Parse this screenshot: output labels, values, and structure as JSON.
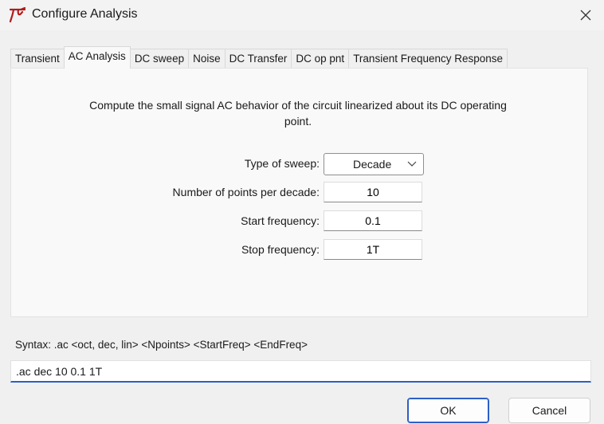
{
  "window": {
    "title": "Configure Analysis",
    "icon": "ltspice-logo-icon",
    "close_icon": "close-icon"
  },
  "tabs": [
    {
      "label": "Transient",
      "active": false
    },
    {
      "label": "AC Analysis",
      "active": true
    },
    {
      "label": "DC sweep",
      "active": false
    },
    {
      "label": "Noise",
      "active": false
    },
    {
      "label": "DC Transfer",
      "active": false
    },
    {
      "label": "DC op pnt",
      "active": false
    },
    {
      "label": "Transient Frequency Response",
      "active": false
    }
  ],
  "panel": {
    "description": "Compute the small signal AC behavior of the circuit linearized about its DC operating point.",
    "sweep_type_label": "Type of sweep:",
    "sweep_type_value": "Decade",
    "points_label": "Number of points per decade:",
    "points_value": "10",
    "start_label": "Start frequency:",
    "start_value": "0.1",
    "stop_label": "Stop frequency:",
    "stop_value": "1T"
  },
  "syntax": "Syntax:  .ac <oct, dec, lin> <Npoints> <StartFreq> <EndFreq>",
  "command": ".ac dec 10 0.1 1T",
  "buttons": {
    "ok": "OK",
    "cancel": "Cancel"
  },
  "colors": {
    "accent": "#2c5fc7",
    "logo": "#b11c1c"
  }
}
